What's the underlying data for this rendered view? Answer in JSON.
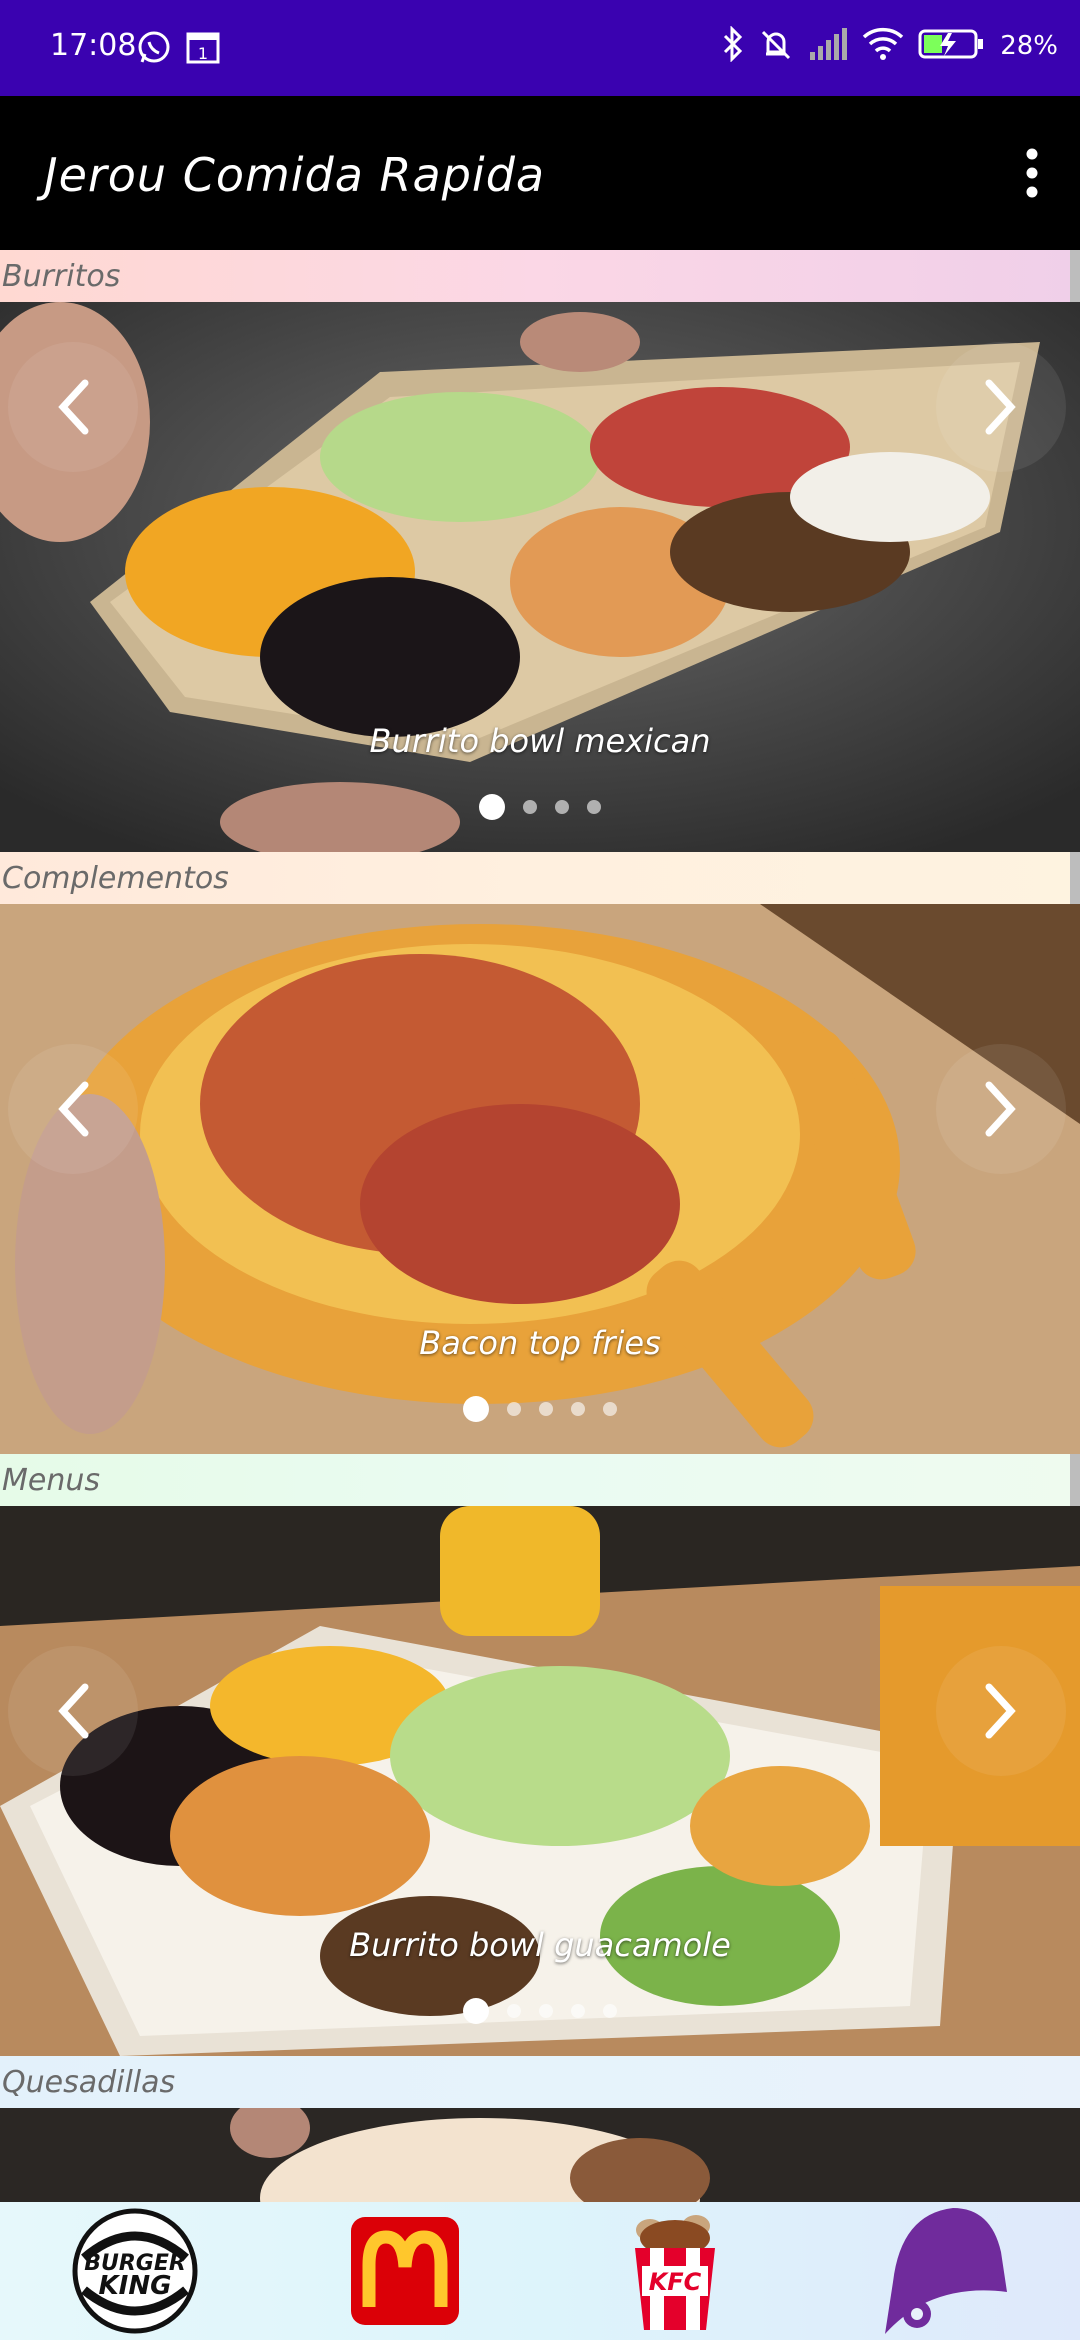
{
  "status_bar": {
    "time": "17:08",
    "notification_box": "1",
    "battery_percent": "28%"
  },
  "app_bar": {
    "title": "Jerou Comida Rapida"
  },
  "sections": [
    {
      "title": "Burritos",
      "caption": "Burrito bowl mexican",
      "dots": 4,
      "active_dot": 0
    },
    {
      "title": "Complementos",
      "caption": "Bacon top fries",
      "dots": 5,
      "active_dot": 0
    },
    {
      "title": "Menus",
      "caption": "Burrito bowl guacamole",
      "dots": 5,
      "active_dot": 0
    },
    {
      "title": "Quesadillas"
    }
  ],
  "bottom_nav": {
    "burger_king": "BURGER KING",
    "mcdonalds": "M",
    "kfc": "KFC"
  },
  "colors": {
    "status_bar": "#3a02b0",
    "app_bar": "#000000",
    "taco_bell": "#702b9c",
    "mcdonalds_red": "#db0007",
    "mcdonalds_yellow": "#ffc72c",
    "kfc_red": "#e4002b"
  }
}
